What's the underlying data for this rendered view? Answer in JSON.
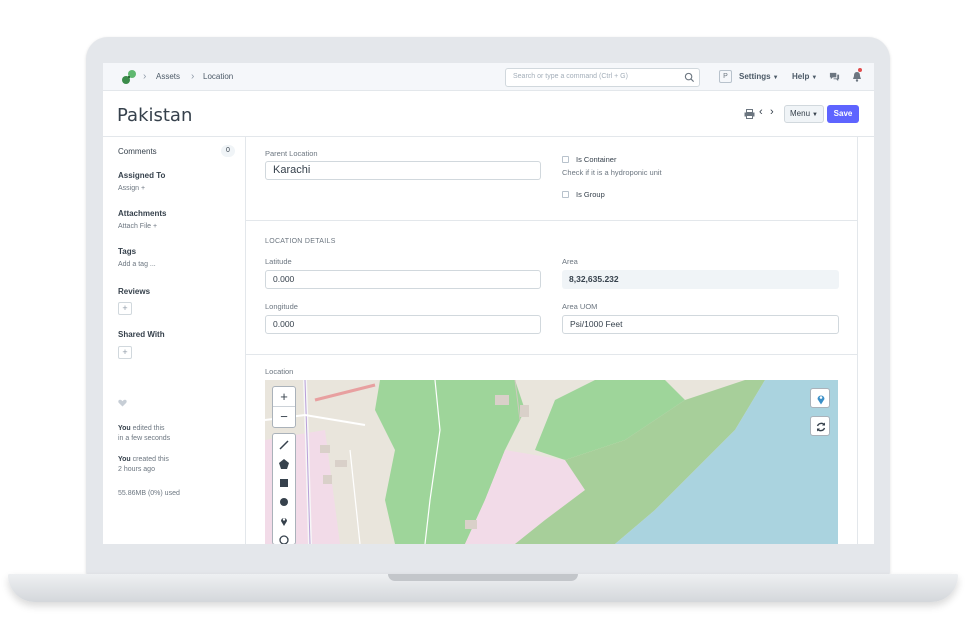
{
  "navbar": {
    "breadcrumbs": [
      "Assets",
      "Location"
    ],
    "search_placeholder": "Search or type a command (Ctrl + G)",
    "avatar_letter": "P",
    "settings_label": "Settings",
    "help_label": "Help"
  },
  "page": {
    "title": "Pakistan",
    "menu_label": "Menu",
    "save_label": "Save"
  },
  "sidebar": {
    "comments_label": "Comments",
    "comments_count": "0",
    "assigned_to_label": "Assigned To",
    "assign_action": "Assign +",
    "attachments_label": "Attachments",
    "attach_action": "Attach File +",
    "tags_label": "Tags",
    "tags_action": "Add a tag ...",
    "reviews_label": "Reviews",
    "shared_with_label": "Shared With",
    "plus": "+",
    "activity": [
      {
        "who": "You",
        "what": " edited this",
        "when": "in a few seconds"
      },
      {
        "who": "You",
        "what": " created this",
        "when": "2 hours ago"
      }
    ],
    "usage": "55.86MB (0%) used"
  },
  "form": {
    "parent_location_label": "Parent Location",
    "parent_location_value": "Karachi",
    "is_container_label": "Is Container",
    "is_container_help": "Check if it is a hydroponic unit",
    "is_group_label": "Is Group",
    "location_details_heading": "LOCATION DETAILS",
    "latitude_label": "Latitude",
    "latitude_value": "0.000",
    "longitude_label": "Longitude",
    "longitude_value": "0.000",
    "area_label": "Area",
    "area_value": "8,32,635.232",
    "area_uom_label": "Area UOM",
    "area_uom_value": "Psi/1000 Feet",
    "location_label": "Location"
  },
  "map": {
    "zoom_in": "+",
    "zoom_out": "−",
    "colors": {
      "water": "#aad3df",
      "park": "#8fd08f",
      "forest": "#add19e",
      "residential": "#f2dbe8",
      "land": "#e9e5dc"
    }
  },
  "colors": {
    "primary": "#5e64ff",
    "text": "#36414c",
    "muted": "#6c7680"
  }
}
